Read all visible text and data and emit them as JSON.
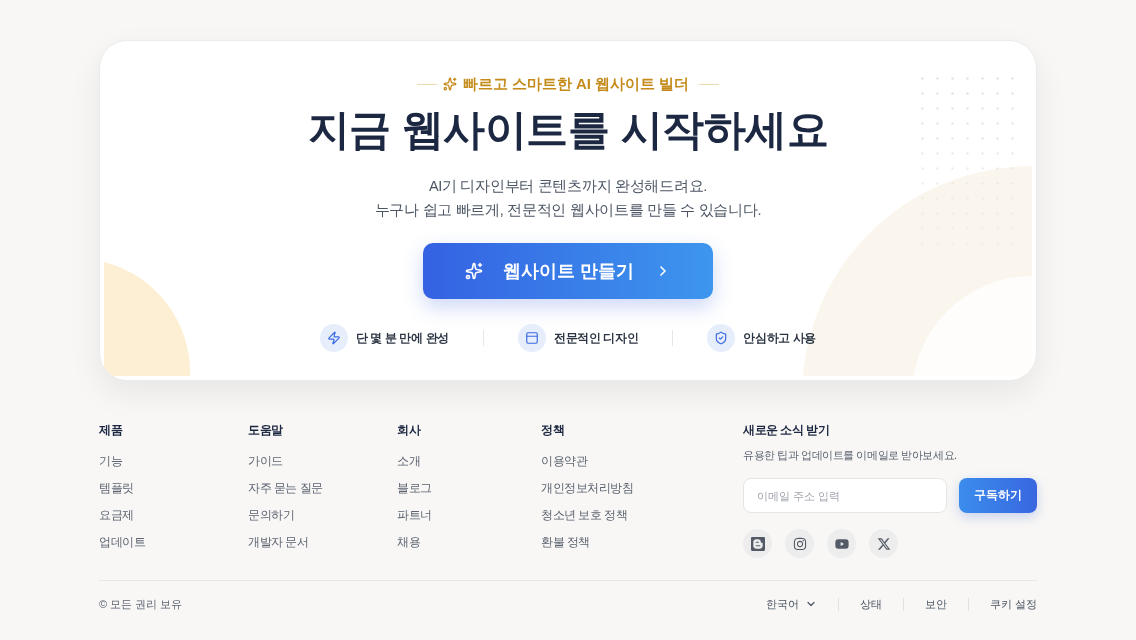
{
  "hero": {
    "eyebrow": "빠르고 스마트한 AI 웹사이트 빌더",
    "title": "지금 웹사이트를 시작하세요",
    "subtitle_lines": [
      "AI기 디자인부터 콘텐츠까지 완성해드려요.",
      "누구나 쉽고 빠르게, 전문적인 웹사이트를 만들 수 있습니다."
    ],
    "cta": "웹사이트 만들기",
    "features": [
      {
        "label": "단 몇 분 만에 완성"
      },
      {
        "label": "전문적인 디자인"
      },
      {
        "label": "안심하고 사용"
      }
    ]
  },
  "footer": {
    "columns": [
      {
        "heading": "제품",
        "links": [
          "기능",
          "템플릿",
          "요금제",
          "업데이트"
        ]
      },
      {
        "heading": "도움말",
        "links": [
          "가이드",
          "자주 묻는 질문",
          "문의하기",
          "개발자 문서"
        ]
      },
      {
        "heading": "회사",
        "links": [
          "소개",
          "블로그",
          "파트너",
          "채용"
        ]
      },
      {
        "heading": "정책",
        "links": [
          "이용약관",
          "개인정보처리방침",
          "청소년 보호 정책",
          "환불 정책"
        ]
      }
    ],
    "newsletter": {
      "heading": "새로운 소식 받기",
      "text": "유용한 팁과 업데이트를 이메일로 받아보세요.",
      "placeholder": "이메일 주소 입력",
      "button": "구독하기"
    },
    "copyright": "© 모든 권리 보유",
    "language": "한국어",
    "bottom_links": [
      "상태",
      "보안",
      "쿠키 설정"
    ]
  }
}
